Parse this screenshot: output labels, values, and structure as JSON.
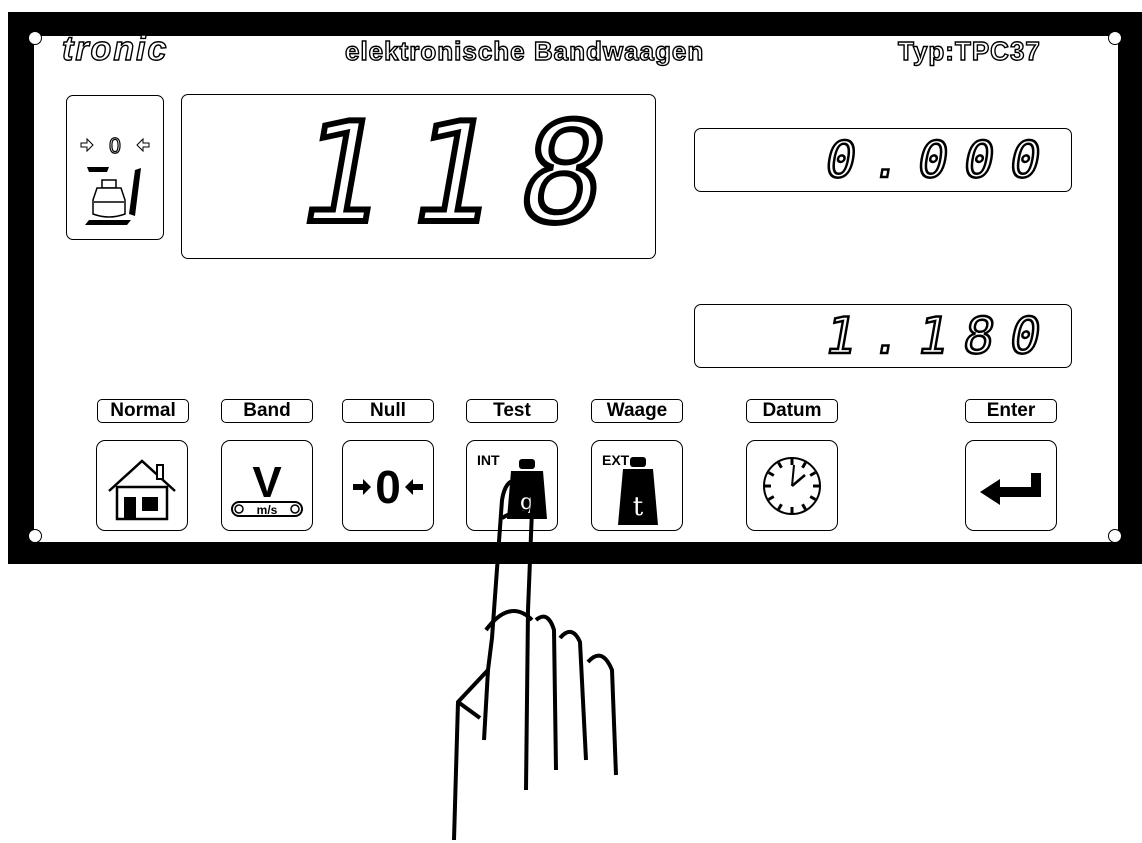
{
  "header": {
    "logo": "tronic",
    "subtitle": "elektronische Bandwaagen",
    "type": "Typ:TPC37"
  },
  "display": {
    "main_value": "118",
    "top_value": "0.000",
    "bottom_value": "1.180",
    "zero_indicator": "0"
  },
  "keys": [
    {
      "label": "Normal",
      "icon": "home-icon"
    },
    {
      "label": "Band",
      "icon": "belt-speed-icon",
      "icon_text": "V",
      "icon_subtext": "m/s"
    },
    {
      "label": "Null",
      "icon": "zero-icon",
      "icon_text": "0"
    },
    {
      "label": "Test",
      "icon": "internal-weight-icon",
      "icon_text": "INT",
      "icon_subtext": "g"
    },
    {
      "label": "Waage",
      "icon": "external-weight-icon",
      "icon_text": "EXT",
      "icon_subtext": "t"
    },
    {
      "label": "Datum",
      "icon": "clock-icon"
    },
    {
      "label": "Enter",
      "icon": "enter-arrow-icon"
    }
  ]
}
